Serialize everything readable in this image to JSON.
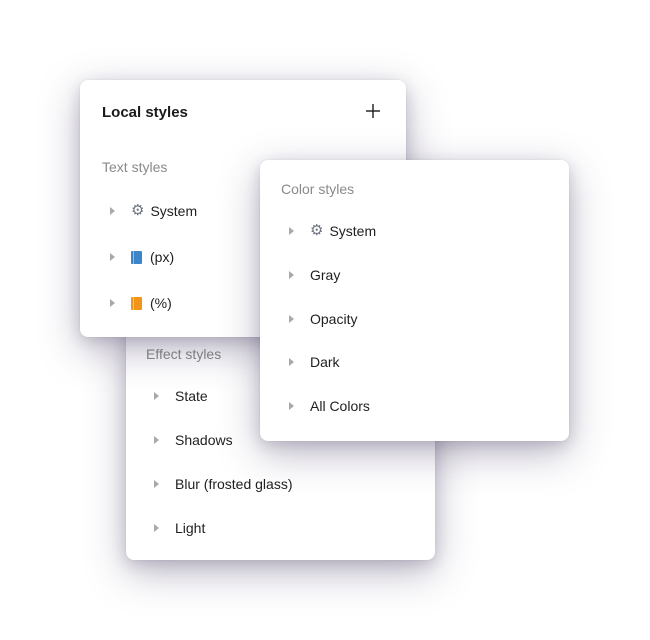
{
  "local_styles": {
    "title": "Local styles",
    "add_icon": "plus-icon",
    "text_section": {
      "label": "Text styles",
      "items": [
        {
          "icon": "gear-icon",
          "label": "System"
        },
        {
          "icon": "blue-book-icon",
          "label": "(px)"
        },
        {
          "icon": "orange-book-icon",
          "label": "(%)"
        }
      ]
    }
  },
  "color_styles": {
    "label": "Color styles",
    "items": [
      {
        "icon": "gear-icon",
        "label": "System"
      },
      {
        "label": "Gray"
      },
      {
        "label": "Opacity"
      },
      {
        "label": "Dark"
      },
      {
        "label": "All Colors"
      }
    ]
  },
  "effect_styles": {
    "label": "Effect styles",
    "items": [
      {
        "label": "State"
      },
      {
        "label": "Shadows"
      },
      {
        "label": "Blur (frosted glass)"
      },
      {
        "label": "Light"
      }
    ]
  },
  "colors": {
    "section_label": "#8a8a8a",
    "caret": "#a9a9a9",
    "book_blue": "#3d85c8",
    "book_orange": "#f1951a"
  }
}
